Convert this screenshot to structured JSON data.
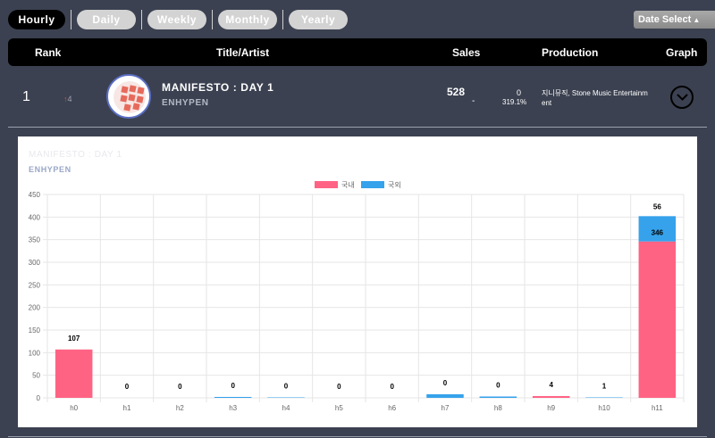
{
  "tabs": [
    {
      "label": "Hourly",
      "active": true
    },
    {
      "label": "Daily",
      "active": false
    },
    {
      "label": "Weekly",
      "active": false
    },
    {
      "label": "Monthly",
      "active": false
    },
    {
      "label": "Yearly",
      "active": false
    }
  ],
  "date_select": {
    "label": "Date Select",
    "icon": "up-down-arrows-icon"
  },
  "header": {
    "rank": "Rank",
    "title_artist": "Title/Artist",
    "sales": "Sales",
    "production": "Production",
    "graph": "Graph"
  },
  "entry": {
    "rank": "1",
    "change_arrow": "↑",
    "change_value": "4",
    "title": "MANIFESTO : DAY 1",
    "artist": "ENHYPEN",
    "sales": "528",
    "sales_dash": "-",
    "sub_value": "0",
    "sub_percent": "319.1%",
    "production": "지니뮤직, Stone Music Entertainment",
    "graph_icon": "chevron-down-circle-icon"
  },
  "panel": {
    "title": "MANIFESTO : DAY 1",
    "artist": "ENHYPEN"
  },
  "colors": {
    "domestic": "#ff6384",
    "foreign": "#36a2eb"
  },
  "chart_data": {
    "type": "bar",
    "stacked": true,
    "categories": [
      "h0",
      "h1",
      "h2",
      "h3",
      "h4",
      "h5",
      "h6",
      "h7",
      "h8",
      "h9",
      "h10",
      "h11"
    ],
    "series": [
      {
        "name": "국내",
        "values": [
          107,
          0,
          0,
          0,
          0,
          0,
          0,
          0,
          0,
          4,
          0,
          346
        ]
      },
      {
        "name": "국외",
        "values": [
          0,
          0,
          0,
          2,
          1,
          0,
          0,
          8,
          3,
          0,
          1,
          56
        ]
      }
    ],
    "data_labels": [
      "107",
      "0",
      "0",
      "0",
      "0",
      "0",
      "0",
      "0",
      "0",
      "4",
      "1",
      "346"
    ],
    "top_labels": {
      "11": "56"
    },
    "ylim": [
      0,
      450
    ],
    "yticks": [
      0,
      50,
      100,
      150,
      200,
      250,
      300,
      350,
      400,
      450
    ],
    "legend_position": "top-center",
    "grid": true
  }
}
